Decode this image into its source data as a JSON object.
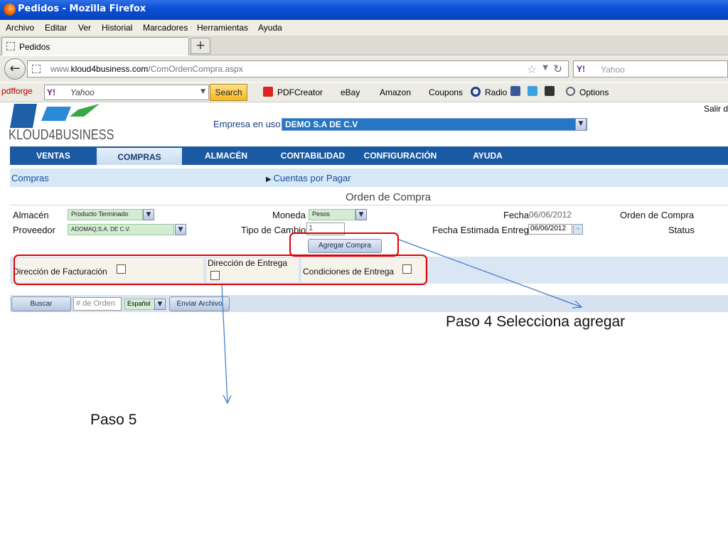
{
  "window": {
    "title": "Pedidos - Mozilla Firefox"
  },
  "menu": [
    "Archivo",
    "Editar",
    "Ver",
    "Historial",
    "Marcadores",
    "Herramientas",
    "Ayuda"
  ],
  "tab": {
    "label": "Pedidos",
    "new_tab": "+"
  },
  "address": {
    "url_prefix": "www.",
    "url_domain": "kloud4business.com",
    "url_path": "/ComOrdenCompra.aspx"
  },
  "browser_search": {
    "placeholder": "Yahoo",
    "engine": "Y!"
  },
  "toolbar": {
    "pdfforge": "pdfforge",
    "search_value": "Yahoo",
    "search_button": "Search",
    "items": [
      "PDFCreator",
      "eBay",
      "Amazon",
      "Coupons",
      "Radio",
      "Options"
    ]
  },
  "app": {
    "logo_text": "KLOUD4BUSINESS",
    "salir": "Salir d",
    "empresa_label": "Empresa en uso:",
    "empresa_value": "DEMO S.A DE C.V",
    "nav": [
      "VENTAS",
      "COMPRAS",
      "ALMACÉN",
      "CONTABILIDAD",
      "CONFIGURACIÓN",
      "AYUDA"
    ],
    "breadcrumb": {
      "current": "Compras",
      "link": "Cuentas por Pagar"
    },
    "heading": "Orden de Compra",
    "form": {
      "almacen_label": "Almacén",
      "almacen_value": "Producto Terminado",
      "proveedor_label": "Proveedor",
      "proveedor_value": "ADOMAQ,S.A. DE C.V.",
      "moneda_label": "Moneda",
      "moneda_value": "Pesos",
      "tipo_cambio_label": "Tipo de Cambio",
      "tipo_cambio_value": "1",
      "fecha_label": "Fecha",
      "fecha_value": "06/06/2012",
      "fecha_est_label": "Fecha Estimada Entrega",
      "fecha_est_value": "06/06/2012",
      "orden_label": "Orden de Compra",
      "status_label": "Status",
      "agregar_button": "Agregar Compra"
    },
    "options": {
      "facturacion": "Dirección de Facturación",
      "entrega": "Dirección de Entrega",
      "condiciones": "Condiciones de Entrega"
    },
    "bottom": {
      "buscar": "Buscar",
      "orden_placeholder": "# de Orden",
      "idioma": "Español",
      "enviar": "Enviar Archivo"
    }
  },
  "annotations": {
    "paso4": "Paso 4 Selecciona agregar",
    "paso5": "Paso 5"
  },
  "colors": {
    "nav_blue": "#1a5aa2",
    "highlight_red": "#e00000",
    "arrow_blue": "#3a78c8"
  }
}
